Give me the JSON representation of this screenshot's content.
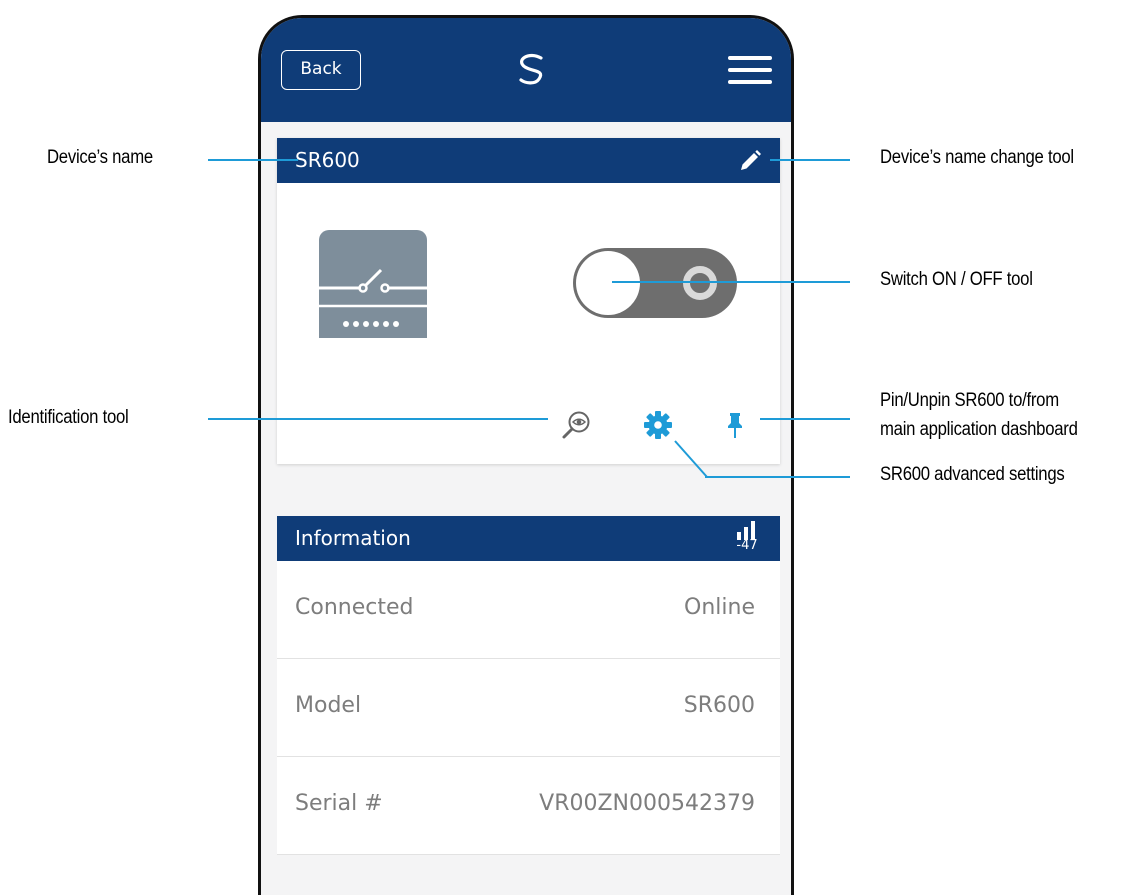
{
  "header": {
    "back_label": "Back"
  },
  "device_card": {
    "title": "SR600",
    "edit_icon": "pencil-icon",
    "relay_icon": "relay-switch-icon",
    "switch_state": "off",
    "tools": [
      {
        "name": "identify",
        "icon": "magnifier-eye-icon"
      },
      {
        "name": "settings",
        "icon": "gear-icon"
      },
      {
        "name": "pin",
        "icon": "pin-icon"
      }
    ]
  },
  "information": {
    "title": "Information",
    "signal_value": "-47",
    "rows": [
      {
        "key": "Connected",
        "value": "Online"
      },
      {
        "key": "Model",
        "value": "SR600"
      },
      {
        "key": "Serial #",
        "value": "VR00ZN000542379"
      }
    ]
  },
  "annotations": {
    "device_name": "Device’s name",
    "name_change_tool": "Device’s name change tool",
    "switch_tool": "Switch ON / OFF tool",
    "identification_tool": "Identification tool",
    "pin_tool_line1": "Pin/Unpin SR600 to/from",
    "pin_tool_line2": "main application dashboard",
    "advanced_settings": "SR600 advanced settings"
  },
  "colors": {
    "header_blue": "#0f3c78",
    "accent_blue": "#1e9bd7",
    "toggle_gray": "#6e6e6e",
    "relay_tile": "#7e8e9b"
  }
}
